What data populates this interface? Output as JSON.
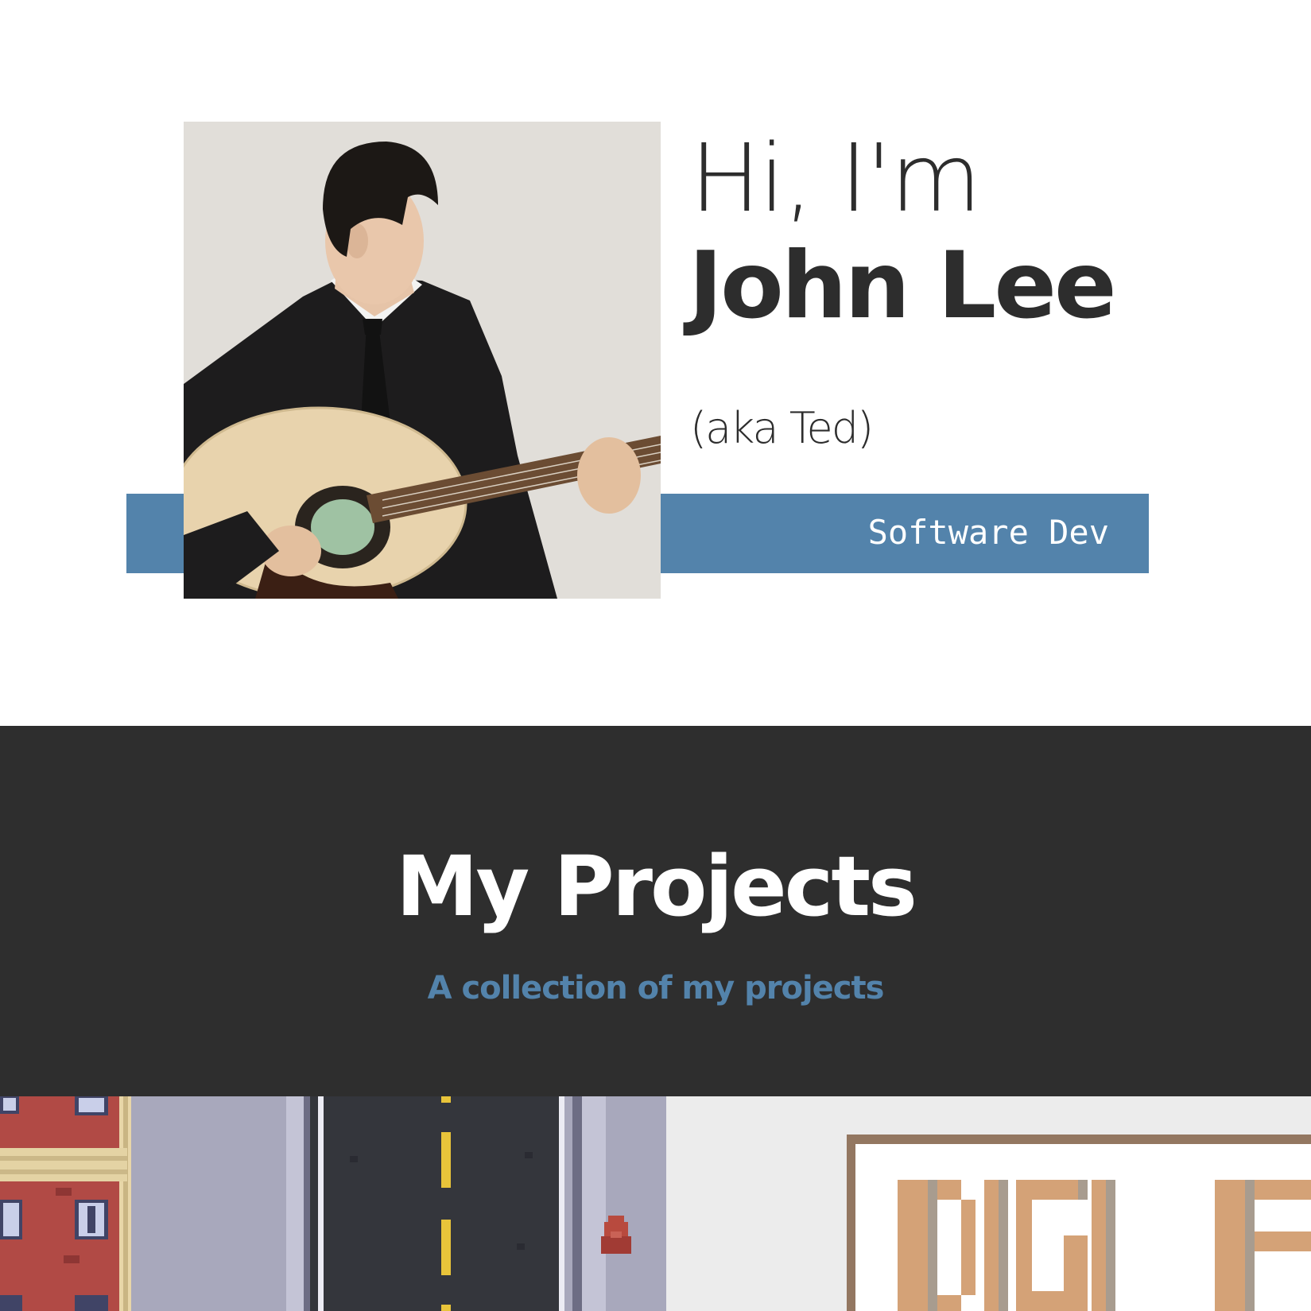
{
  "hero": {
    "greeting": "Hi, I'm",
    "name": "John Lee",
    "nickname": "(aka Ted)",
    "role": "Software Dev",
    "photo_alt": "photo of a man in a suit playing an acoustic guitar",
    "accent_color": "#5383ab"
  },
  "projects": {
    "title": "My Projects",
    "subtitle": "A collection of my projects",
    "background_color": "#2e2e2e",
    "thumbnails": [
      {
        "name": "pixel-city-game-thumbnail"
      },
      {
        "name": "digi-pixel-logo-thumbnail"
      }
    ]
  }
}
